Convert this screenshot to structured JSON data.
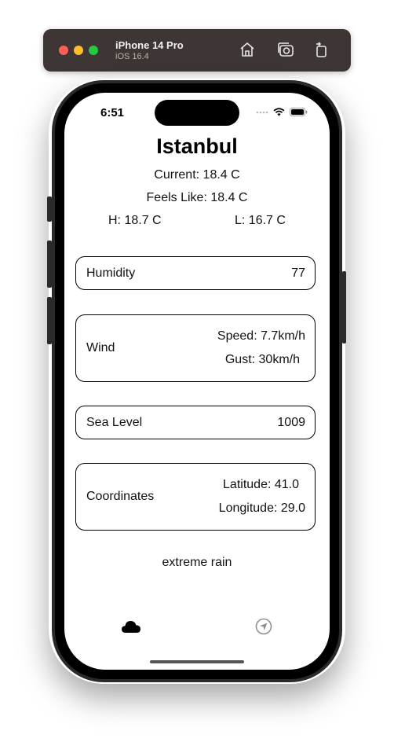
{
  "window": {
    "device_name": "iPhone 14 Pro",
    "os_version": "iOS 16.4",
    "icons": [
      "home-icon",
      "screenshot-icon",
      "rotate-icon"
    ]
  },
  "status_bar": {
    "time": "6:51"
  },
  "weather": {
    "city": "Istanbul",
    "current": "Current: 18.4 C",
    "feels_like": "Feels Like: 18.4 C",
    "high": "H: 18.7 C",
    "low": "L: 16.7 C"
  },
  "cards": {
    "humidity": {
      "label": "Humidity",
      "value": "77"
    },
    "wind": {
      "label": "Wind",
      "speed": "Speed: 7.7km/h",
      "gust": "Gust: 30km/h"
    },
    "sea_level": {
      "label": "Sea Level",
      "value": "1009"
    },
    "coordinates": {
      "label": "Coordinates",
      "latitude": "Latitude: 41.0",
      "longitude": "Longitude: 29.0"
    }
  },
  "condition": "extreme rain",
  "tab_bar": {
    "tabs": [
      {
        "icon": "cloud-icon",
        "selected": true
      },
      {
        "icon": "location-arrow-icon",
        "selected": false
      }
    ]
  },
  "colors": {
    "toolbar_bg": "#3d3634",
    "screen_bg": "#ffffff",
    "card_border": "#000000"
  }
}
